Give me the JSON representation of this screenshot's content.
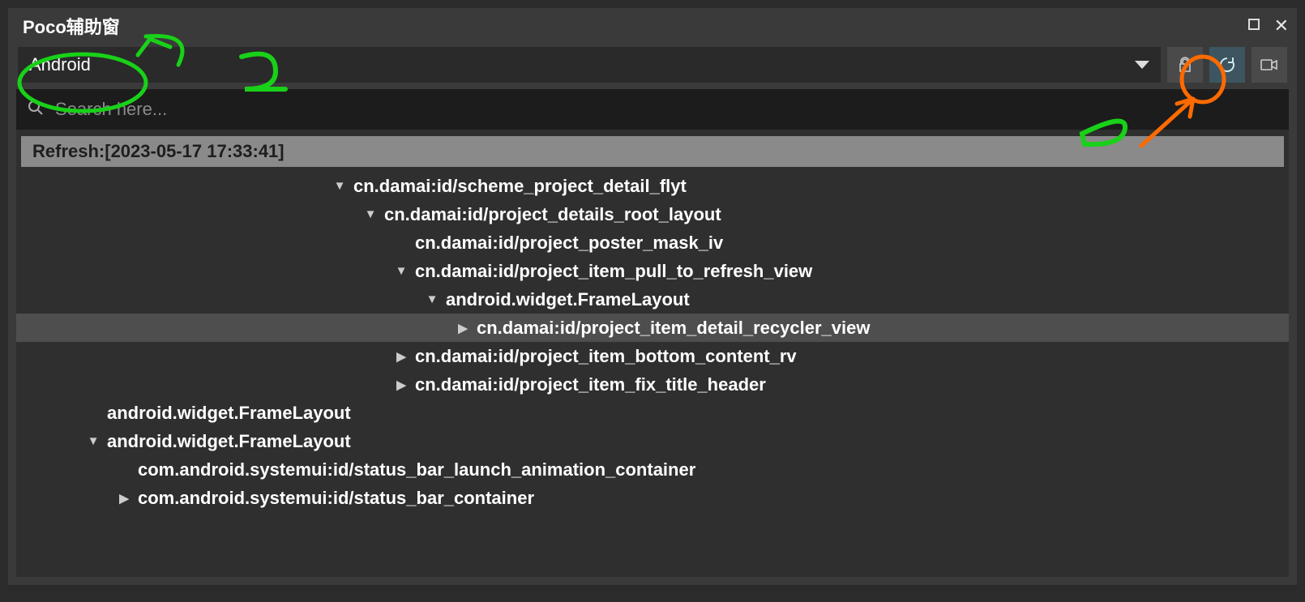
{
  "window": {
    "title": "Poco辅助窗"
  },
  "dropdown": {
    "value": "Android"
  },
  "search": {
    "placeholder": "Search here..."
  },
  "refresh_bar": "Refresh:[2023-05-17 17:33:41]",
  "tree": [
    {
      "indent": 10,
      "arrow": "down",
      "label": "cn.damai:id/scheme_project_detail_flyt",
      "selected": false
    },
    {
      "indent": 11,
      "arrow": "down",
      "label": "cn.damai:id/project_details_root_layout",
      "selected": false
    },
    {
      "indent": 12,
      "arrow": "none",
      "label": "cn.damai:id/project_poster_mask_iv",
      "selected": false
    },
    {
      "indent": 12,
      "arrow": "down",
      "label": "cn.damai:id/project_item_pull_to_refresh_view",
      "selected": false
    },
    {
      "indent": 13,
      "arrow": "down",
      "label": "android.widget.FrameLayout",
      "selected": false
    },
    {
      "indent": 14,
      "arrow": "right",
      "label": "cn.damai:id/project_item_detail_recycler_view",
      "selected": true
    },
    {
      "indent": 12,
      "arrow": "right",
      "label": "cn.damai:id/project_item_bottom_content_rv",
      "selected": false
    },
    {
      "indent": 12,
      "arrow": "right",
      "label": "cn.damai:id/project_item_fix_title_header",
      "selected": false
    },
    {
      "indent": 2,
      "arrow": "none",
      "label": "android.widget.FrameLayout",
      "selected": false
    },
    {
      "indent": 2,
      "arrow": "down",
      "label": "android.widget.FrameLayout",
      "selected": false
    },
    {
      "indent": 3,
      "arrow": "none",
      "label": "com.android.systemui:id/status_bar_launch_animation_container",
      "selected": false
    },
    {
      "indent": 3,
      "arrow": "right",
      "label": "com.android.systemui:id/status_bar_container",
      "selected": false
    }
  ]
}
